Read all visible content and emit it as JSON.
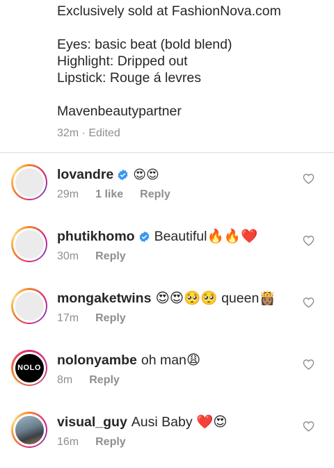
{
  "caption": {
    "line1": "Exclusively sold at FashionNova.com",
    "line2": "Eyes: basic beat (bold blend)",
    "line3": "Highlight: Dripped out",
    "line4": "Lipstick: Rouge á levres",
    "line5": "Mavenbeautypartner",
    "meta": "32m · Edited"
  },
  "comments": [
    {
      "username": "lovandre",
      "verified": true,
      "text": "😍😍",
      "time": "29m",
      "likes": "1 like",
      "reply": "Reply"
    },
    {
      "username": "phutikhomo",
      "verified": true,
      "text": "Beautiful🔥🔥❤️",
      "time": "30m",
      "reply": "Reply"
    },
    {
      "username": "mongaketwins",
      "verified": false,
      "text": "😍😍🥺🥺 queen👸🏽",
      "time": "17m",
      "reply": "Reply"
    },
    {
      "username": "nolonyambe",
      "verified": false,
      "text": "oh man😩",
      "time": "8m",
      "reply": "Reply",
      "avatar_text": "NOLO"
    },
    {
      "username": "visual_guy",
      "verified": false,
      "text": "Ausi Baby ❤️😍",
      "time": "16m",
      "reply": "Reply"
    }
  ],
  "icons": {
    "heart": "heart-outline-icon",
    "verified": "verified-badge-icon"
  },
  "colors": {
    "verified": "#3897f0",
    "muted": "#8e8e8e",
    "text": "#262626",
    "divider": "#dbdbdb"
  }
}
